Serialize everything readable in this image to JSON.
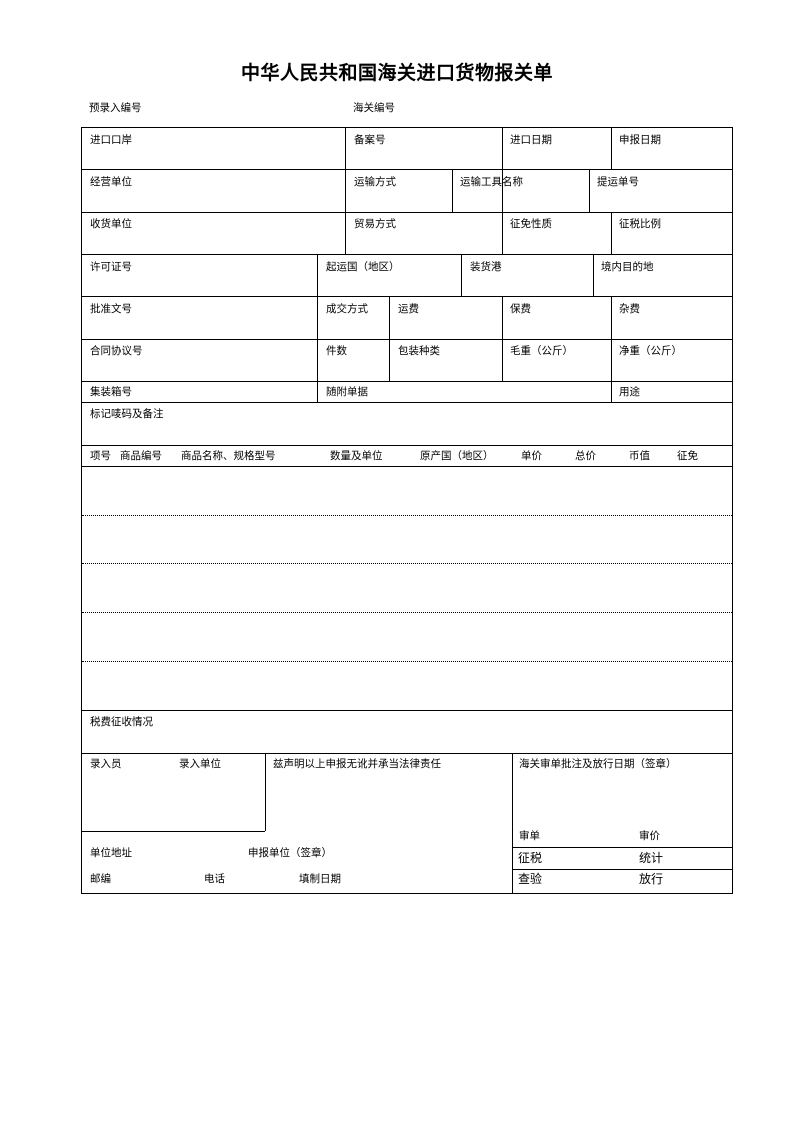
{
  "title": "中华人民共和国海关进口货物报关单",
  "pre_entry_no_label": "预录入编号",
  "customs_no_label": "海关编号",
  "rows": {
    "r1": [
      "进口口岸",
      "备案号",
      "进口日期",
      "申报日期"
    ],
    "r2": [
      "经营单位",
      "运输方式",
      "运输工具名称",
      "提运单号"
    ],
    "r3": [
      "收货单位",
      "贸易方式",
      "征免性质",
      "征税比例"
    ],
    "r4": [
      "许可证号",
      "起运国（地区）",
      "装货港",
      "境内目的地"
    ],
    "r5": [
      "批准文号",
      "成交方式",
      "运费",
      "保费",
      "杂费"
    ],
    "r6": [
      "合同协议号",
      "件数",
      "包装种类",
      "毛重（公斤）",
      "净重（公斤）"
    ],
    "r7": [
      "集装箱号",
      "随附单据",
      "用途"
    ],
    "r8": [
      "标记唛码及备注"
    ]
  },
  "goods_header": [
    "项号",
    "商品编号",
    "商品名称、规格型号",
    "数量及单位",
    "原产国（地区）",
    "单价",
    "总价",
    "币值",
    "征免"
  ],
  "goods_rows": [
    "",
    "",
    "",
    "",
    ""
  ],
  "tax_label": "税费征收情况",
  "bottom": {
    "entry_clerk": "录入员",
    "entry_unit": "录入单位",
    "declaration": "兹声明以上申报无讹并承当法律责任",
    "customs_approval": "海关审单批注及放行日期（签章）",
    "unit_address": "单位地址",
    "declaring_unit": "申报单位（签章）",
    "postcode": "邮编",
    "phone": "电话",
    "fill_date": "填制日期",
    "review": "审单",
    "price_review": "审价",
    "levy_tax": "征税",
    "statistics": "统计",
    "inspection": "查验",
    "release": "放行"
  }
}
